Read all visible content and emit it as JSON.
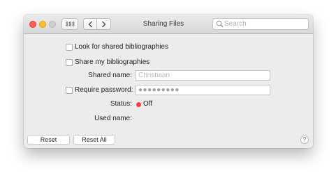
{
  "window": {
    "title": "Sharing Files"
  },
  "search": {
    "placeholder": "Search"
  },
  "options": {
    "look_for_shared": {
      "label": "Look for shared bibliographies",
      "checked": false
    },
    "share_my": {
      "label": "Share my bibliographies",
      "checked": false
    },
    "shared_name": {
      "label": "Shared name:",
      "placeholder": "Christiaan"
    },
    "require_password": {
      "label": "Require password:",
      "checked": false,
      "value": "●●●●●●●●●"
    },
    "status": {
      "label": "Status:",
      "value": "Off",
      "color": "#fb3a3d"
    },
    "used_name": {
      "label": "Used name:",
      "value": ""
    }
  },
  "buttons": {
    "reset": "Reset",
    "reset_all": "Reset All",
    "help": "?"
  },
  "icons": {
    "grid": "grid-icon",
    "back": "chevron-left-icon",
    "forward": "chevron-right-icon",
    "search": "search-icon"
  }
}
